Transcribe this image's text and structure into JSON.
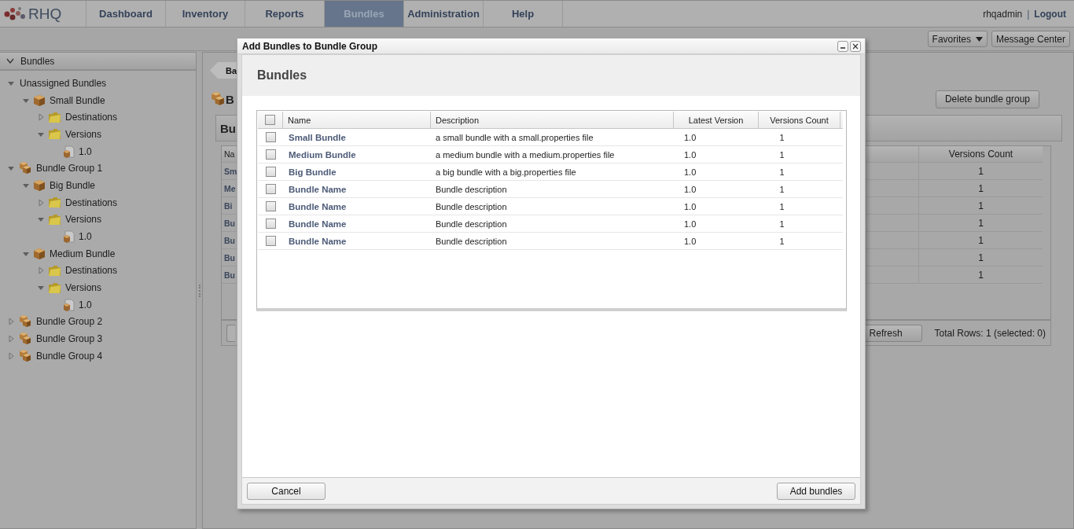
{
  "nav": {
    "logo": "RHQ",
    "tabs": [
      {
        "label": "Dashboard",
        "selected": false
      },
      {
        "label": "Inventory",
        "selected": false
      },
      {
        "label": "Reports",
        "selected": false
      },
      {
        "label": "Bundles",
        "selected": true
      },
      {
        "label": "Administration",
        "selected": false
      },
      {
        "label": "Help",
        "selected": false
      }
    ],
    "user": "rhqadmin",
    "separator": "|",
    "logout": "Logout"
  },
  "toolbar": {
    "favorites": "Favorites",
    "message_center": "Message Center"
  },
  "sidebar": {
    "title": "Bundles",
    "tree": [
      {
        "kind": "root",
        "label": "Unassigned Bundles",
        "expanded": true,
        "children": [
          {
            "kind": "bundle",
            "label": "Small Bundle",
            "expanded": true,
            "children": [
              {
                "kind": "folder",
                "label": "Destinations",
                "expanded": false
              },
              {
                "kind": "folder",
                "label": "Versions",
                "expanded": true,
                "children": [
                  {
                    "kind": "version",
                    "label": "1.0"
                  }
                ]
              }
            ]
          }
        ]
      },
      {
        "kind": "group",
        "label": "Bundle Group 1",
        "expanded": true,
        "children": [
          {
            "kind": "bundle",
            "label": "Big Bundle",
            "expanded": true,
            "children": [
              {
                "kind": "folder",
                "label": "Destinations",
                "expanded": false
              },
              {
                "kind": "folder",
                "label": "Versions",
                "expanded": true,
                "children": [
                  {
                    "kind": "version",
                    "label": "1.0"
                  }
                ]
              }
            ]
          },
          {
            "kind": "bundle",
            "label": "Medium Bundle",
            "expanded": true,
            "children": [
              {
                "kind": "folder",
                "label": "Destinations",
                "expanded": false
              },
              {
                "kind": "folder",
                "label": "Versions",
                "expanded": true,
                "children": [
                  {
                    "kind": "version",
                    "label": "1.0"
                  }
                ]
              }
            ]
          }
        ]
      },
      {
        "kind": "group",
        "label": "Bundle Group 2",
        "expanded": false
      },
      {
        "kind": "group",
        "label": "Bundle Group 3",
        "expanded": false
      },
      {
        "kind": "group",
        "label": "Bundle Group 4",
        "expanded": false
      }
    ]
  },
  "main": {
    "back": "Ba",
    "title": "B",
    "section": "Bu",
    "delete_button": "Delete bundle group",
    "table": {
      "column_1": "Na",
      "column_2": "Versions Count",
      "rows": [
        {
          "column_1": "Sm",
          "column_2": "1"
        },
        {
          "column_1": "Me",
          "column_2": "1"
        },
        {
          "column_1": "Bi",
          "column_2": "1"
        },
        {
          "column_1": "Bu",
          "column_2": "1"
        },
        {
          "column_1": "Bu",
          "column_2": "1"
        },
        {
          "column_1": "Bu",
          "column_2": "1"
        },
        {
          "column_1": "Bu",
          "column_2": "1"
        }
      ]
    },
    "refresh": "Refresh",
    "total": "Total Rows: 1 (selected: 0)"
  },
  "dialog": {
    "title": "Add Bundles to Bundle Group",
    "heading": "Bundles",
    "table": {
      "all_checked": false,
      "columns": [
        "Name",
        "Description",
        "Latest Version",
        "Versions Count"
      ],
      "rows": [
        {
          "checked": false,
          "name": "Small Bundle",
          "description": "a small bundle with a small.properties file",
          "latest_version": "1.0",
          "versions_count": "1"
        },
        {
          "checked": false,
          "name": "Medium Bundle",
          "description": "a medium bundle with a medium.properties file",
          "latest_version": "1.0",
          "versions_count": "1"
        },
        {
          "checked": false,
          "name": "Big Bundle",
          "description": "a big bundle with a big.properties file",
          "latest_version": "1.0",
          "versions_count": "1"
        },
        {
          "checked": false,
          "name": "Bundle Name",
          "description": "Bundle description",
          "latest_version": "1.0",
          "versions_count": "1"
        },
        {
          "checked": false,
          "name": "Bundle Name",
          "description": "Bundle description",
          "latest_version": "1.0",
          "versions_count": "1"
        },
        {
          "checked": false,
          "name": "Bundle Name",
          "description": "Bundle description",
          "latest_version": "1.0",
          "versions_count": "1"
        },
        {
          "checked": false,
          "name": "Bundle Name",
          "description": "Bundle description",
          "latest_version": "1.0",
          "versions_count": "1"
        }
      ]
    },
    "cancel": "Cancel",
    "submit": "Add bundles"
  }
}
